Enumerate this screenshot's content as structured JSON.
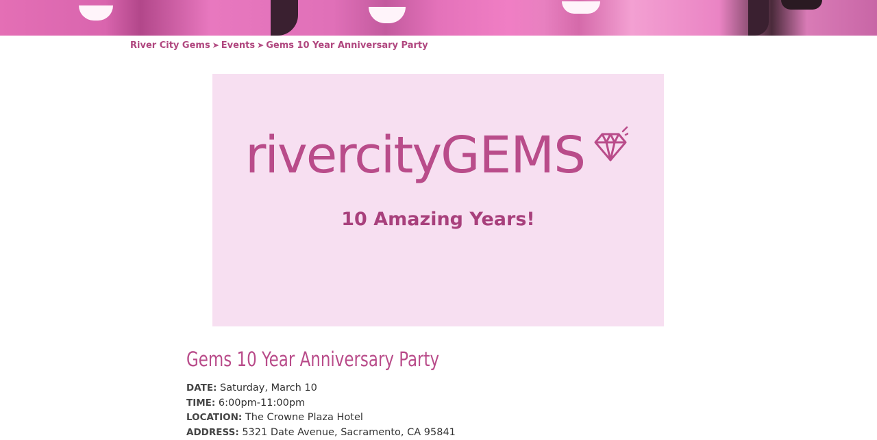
{
  "breadcrumb": {
    "items": [
      "River City Gems",
      "Events",
      "Gems 10 Year Anniversary Party"
    ],
    "separator": "➤"
  },
  "banner": {
    "logo_light": "rivercity",
    "logo_bold": "GEMS",
    "tagline": "10 Amazing Years!",
    "background": "#f7dff1",
    "accent": "#b94c8a"
  },
  "event": {
    "title": "Gems 10 Year Anniversary Party",
    "details": [
      {
        "label": "DATE:",
        "value": "Saturday, March 10"
      },
      {
        "label": "TIME:",
        "value": "6:00pm-11:00pm"
      },
      {
        "label": "LOCATION:",
        "value": "The Crowne Plaza Hotel"
      },
      {
        "label": "ADDRESS:",
        "value": "5321 Date Avenue, Sacramento, CA 95841"
      }
    ]
  },
  "icons": {
    "gem": "diamond-icon"
  }
}
